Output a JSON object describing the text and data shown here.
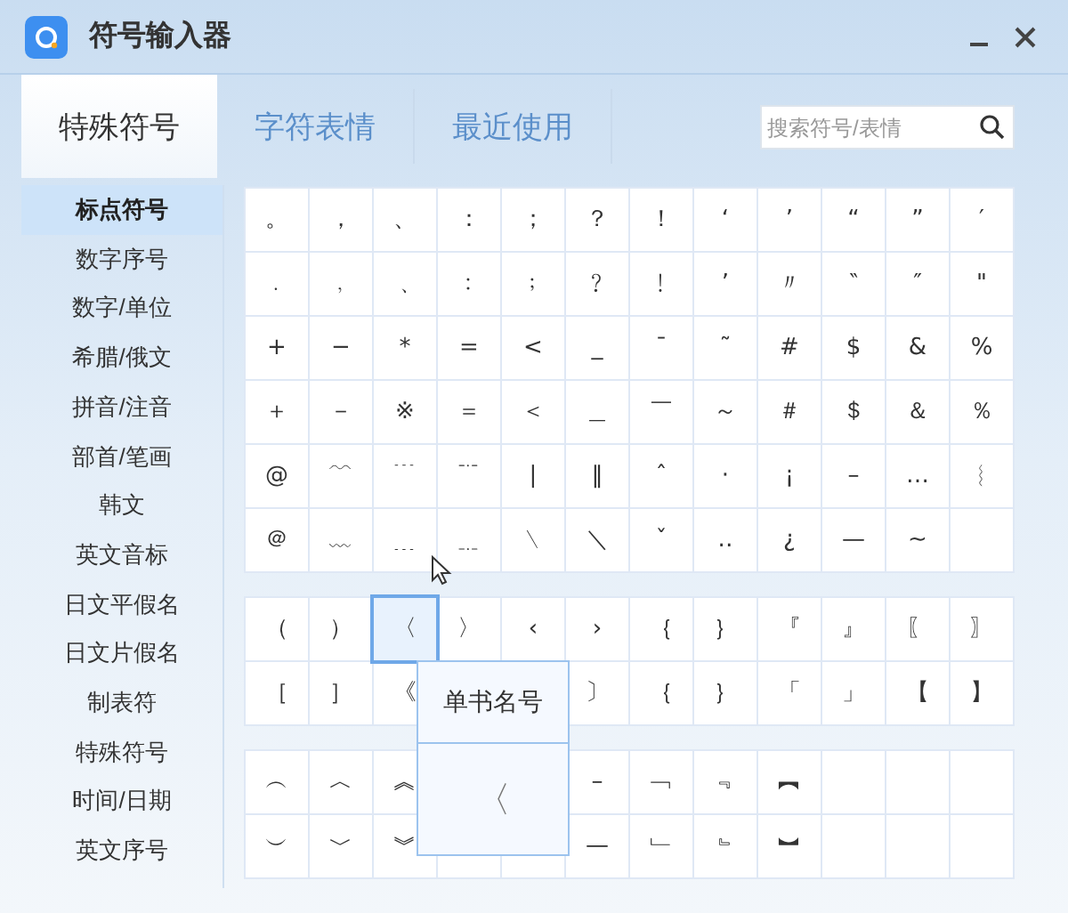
{
  "window": {
    "title": "符号输入器"
  },
  "tabs": [
    {
      "label": "特殊符号",
      "selected": true
    },
    {
      "label": "字符表情",
      "selected": false
    },
    {
      "label": "最近使用",
      "selected": false
    }
  ],
  "search": {
    "placeholder": "搜索符号/表情"
  },
  "sidebar": {
    "items": [
      {
        "label": "标点符号",
        "selected": true
      },
      {
        "label": "数字序号",
        "selected": false
      },
      {
        "label": "数字/单位",
        "selected": false
      },
      {
        "label": "希腊/俄文",
        "selected": false
      },
      {
        "label": "拼音/注音",
        "selected": false
      },
      {
        "label": "部首/笔画",
        "selected": false
      },
      {
        "label": "韩文",
        "selected": false
      },
      {
        "label": "英文音标",
        "selected": false
      },
      {
        "label": "日文平假名",
        "selected": false
      },
      {
        "label": "日文片假名",
        "selected": false
      },
      {
        "label": "制表符",
        "selected": false
      },
      {
        "label": "特殊符号",
        "selected": false
      },
      {
        "label": "时间/日期",
        "selected": false
      },
      {
        "label": "英文序号",
        "selected": false
      }
    ]
  },
  "blocks": [
    {
      "rows": [
        [
          {
            "symbol": "。",
            "selected": false
          },
          {
            "symbol": "，",
            "selected": false
          },
          {
            "symbol": "、",
            "selected": false
          },
          {
            "symbol": "：",
            "selected": false
          },
          {
            "symbol": "；",
            "selected": false
          },
          {
            "symbol": "？",
            "selected": false
          },
          {
            "symbol": "！",
            "selected": false
          },
          {
            "symbol": "‘",
            "selected": false
          },
          {
            "symbol": "’",
            "selected": false
          },
          {
            "symbol": "“",
            "selected": false
          },
          {
            "symbol": "”",
            "selected": false
          },
          {
            "symbol": "′",
            "selected": false
          }
        ],
        [
          {
            "symbol": "﹒",
            "selected": false
          },
          {
            "symbol": "﹐",
            "selected": false
          },
          {
            "symbol": "﹑",
            "selected": false
          },
          {
            "symbol": "﹕",
            "selected": false
          },
          {
            "symbol": "﹔",
            "selected": false
          },
          {
            "symbol": "﹖",
            "selected": false
          },
          {
            "symbol": "﹗",
            "selected": false
          },
          {
            "symbol": "ʼ",
            "selected": false
          },
          {
            "symbol": "〃",
            "selected": false
          },
          {
            "symbol": "‶",
            "selected": false
          },
          {
            "symbol": "″",
            "selected": false
          },
          {
            "symbol": "\"",
            "selected": false
          }
        ],
        [
          {
            "symbol": "+",
            "selected": false
          },
          {
            "symbol": "−",
            "selected": false
          },
          {
            "symbol": "*",
            "selected": false
          },
          {
            "symbol": "=",
            "selected": false
          },
          {
            "symbol": "<",
            "selected": false
          },
          {
            "symbol": "_",
            "selected": false
          },
          {
            "symbol": "¯",
            "selected": false
          },
          {
            "symbol": "˜",
            "selected": false
          },
          {
            "symbol": "#",
            "selected": false
          },
          {
            "symbol": "$",
            "selected": false
          },
          {
            "symbol": "&",
            "selected": false
          },
          {
            "symbol": "%",
            "selected": false
          }
        ],
        [
          {
            "symbol": "＋",
            "selected": false
          },
          {
            "symbol": "－",
            "selected": false
          },
          {
            "symbol": "※",
            "selected": false
          },
          {
            "symbol": "＝",
            "selected": false
          },
          {
            "symbol": "＜",
            "selected": false
          },
          {
            "symbol": "＿",
            "selected": false
          },
          {
            "symbol": "￣",
            "selected": false
          },
          {
            "symbol": "～",
            "selected": false
          },
          {
            "symbol": "＃",
            "selected": false
          },
          {
            "symbol": "＄",
            "selected": false
          },
          {
            "symbol": "＆",
            "selected": false
          },
          {
            "symbol": "％",
            "selected": false
          }
        ],
        [
          {
            "symbol": "@",
            "selected": false
          },
          {
            "symbol": "﹋",
            "selected": false
          },
          {
            "symbol": "﹉",
            "selected": false
          },
          {
            "symbol": "﹊",
            "selected": false
          },
          {
            "symbol": "|",
            "selected": false
          },
          {
            "symbol": "‖",
            "selected": false
          },
          {
            "symbol": "ˆ",
            "selected": false
          },
          {
            "symbol": "·",
            "selected": false
          },
          {
            "symbol": "¡",
            "selected": false
          },
          {
            "symbol": "–",
            "selected": false
          },
          {
            "symbol": "…",
            "selected": false
          },
          {
            "symbol": "︴",
            "selected": false
          }
        ],
        [
          {
            "symbol": "＠",
            "selected": false
          },
          {
            "symbol": "﹏",
            "selected": false
          },
          {
            "symbol": "﹍",
            "selected": false
          },
          {
            "symbol": "﹎",
            "selected": false
          },
          {
            "symbol": "﹨",
            "selected": false
          },
          {
            "symbol": "＼",
            "selected": false
          },
          {
            "symbol": "ˇ",
            "selected": false
          },
          {
            "symbol": "‥",
            "selected": false
          },
          {
            "symbol": "¿",
            "selected": false
          },
          {
            "symbol": "—",
            "selected": false
          },
          {
            "symbol": "∼",
            "selected": false
          }
        ]
      ]
    },
    {
      "rows": [
        [
          {
            "symbol": "（",
            "selected": false
          },
          {
            "symbol": "）",
            "selected": false
          },
          {
            "symbol": "〈",
            "selected": true
          },
          {
            "symbol": "〉",
            "selected": false
          },
          {
            "symbol": "‹",
            "selected": false
          },
          {
            "symbol": "›",
            "selected": false
          },
          {
            "symbol": "｛",
            "selected": false
          },
          {
            "symbol": "｝",
            "selected": false
          },
          {
            "symbol": "『",
            "selected": false
          },
          {
            "symbol": "』",
            "selected": false
          },
          {
            "symbol": "〖",
            "selected": false
          },
          {
            "symbol": "〗",
            "selected": false
          }
        ],
        [
          {
            "symbol": "［",
            "selected": false
          },
          {
            "symbol": "］",
            "selected": false
          },
          {
            "symbol": "《",
            "selected": false
          },
          null,
          null,
          {
            "symbol": "〕",
            "selected": false
          },
          {
            "symbol": "｛",
            "selected": false
          },
          {
            "symbol": "｝",
            "selected": false
          },
          {
            "symbol": "「",
            "selected": false
          },
          {
            "symbol": "」",
            "selected": false
          },
          {
            "symbol": "【",
            "selected": false
          },
          {
            "symbol": "】",
            "selected": false
          }
        ]
      ],
      "tooltip": {
        "name": "单书名号",
        "symbol": "〈"
      }
    },
    {
      "rows": [
        [
          {
            "symbol": "︵",
            "selected": false
          },
          {
            "symbol": "︿",
            "selected": false
          },
          {
            "symbol": "︽",
            "selected": false
          },
          null,
          null,
          {
            "symbol": "–",
            "selected": false
          },
          {
            "symbol": "﹁",
            "selected": false
          },
          {
            "symbol": "﹃",
            "selected": false
          },
          {
            "symbol": "︻",
            "selected": false
          }
        ],
        [
          {
            "symbol": "︶",
            "selected": false
          },
          {
            "symbol": "﹀",
            "selected": false
          },
          {
            "symbol": "︾",
            "selected": false
          },
          null,
          null,
          {
            "symbol": "—",
            "selected": false
          },
          {
            "symbol": "﹂",
            "selected": false
          },
          {
            "symbol": "﹄",
            "selected": false
          },
          {
            "symbol": "︼",
            "selected": false
          }
        ]
      ]
    }
  ]
}
